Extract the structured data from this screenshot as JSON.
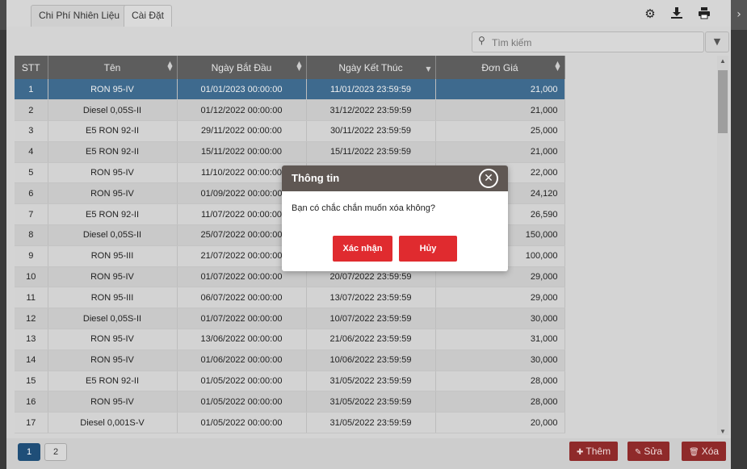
{
  "nav": {
    "collapse_icon": "collapse-left-icon",
    "collapse_glyph": "⏴II",
    "next_icon": "chevron-right-icon"
  },
  "tabs": [
    {
      "label": "Chi Phí Nhiên Liệu"
    },
    {
      "label": "Cài Đặt"
    }
  ],
  "toolbar": {
    "icons": [
      "gear-icon",
      "download-icon",
      "print-icon"
    ]
  },
  "search": {
    "placeholder": "Tìm kiếm",
    "icon": "search-icon"
  },
  "table": {
    "columns": [
      "STT",
      "Tên",
      "Ngày Bắt Đầu",
      "Ngày Kết Thúc",
      "Đơn Giá"
    ],
    "rows": [
      [
        "1",
        "RON 95-IV",
        "01/01/2023 00:00:00",
        "11/01/2023 23:59:59",
        "21,000"
      ],
      [
        "2",
        "Diesel 0,05S-II",
        "01/12/2022 00:00:00",
        "31/12/2022 23:59:59",
        "21,000"
      ],
      [
        "3",
        "E5 RON 92-II",
        "29/11/2022 00:00:00",
        "30/11/2022 23:59:59",
        "25,000"
      ],
      [
        "4",
        "E5 RON 92-II",
        "15/11/2022 00:00:00",
        "15/11/2022 23:59:59",
        "21,000"
      ],
      [
        "5",
        "RON 95-IV",
        "11/10/2022 00:00:00",
        "",
        "22,000"
      ],
      [
        "6",
        "RON 95-IV",
        "01/09/2022 00:00:00",
        "",
        "24,120"
      ],
      [
        "7",
        "E5 RON 92-II",
        "11/07/2022 00:00:00",
        "",
        "26,590"
      ],
      [
        "8",
        "Diesel 0,05S-II",
        "25/07/2022 00:00:00",
        "",
        "150,000"
      ],
      [
        "9",
        "RON 95-III",
        "21/07/2022 00:00:00",
        "",
        "100,000"
      ],
      [
        "10",
        "RON 95-IV",
        "01/07/2022 00:00:00",
        "20/07/2022 23:59:59",
        "29,000"
      ],
      [
        "11",
        "RON 95-III",
        "06/07/2022 00:00:00",
        "13/07/2022 23:59:59",
        "29,000"
      ],
      [
        "12",
        "Diesel 0,05S-II",
        "01/07/2022 00:00:00",
        "10/07/2022 23:59:59",
        "30,000"
      ],
      [
        "13",
        "RON 95-IV",
        "13/06/2022 00:00:00",
        "21/06/2022 23:59:59",
        "31,000"
      ],
      [
        "14",
        "RON 95-IV",
        "01/06/2022 00:00:00",
        "10/06/2022 23:59:59",
        "30,000"
      ],
      [
        "15",
        "E5 RON 92-II",
        "01/05/2022 00:00:00",
        "31/05/2022 23:59:59",
        "28,000"
      ],
      [
        "16",
        "RON 95-IV",
        "01/05/2022 00:00:00",
        "31/05/2022 23:59:59",
        "28,000"
      ],
      [
        "17",
        "Diesel 0,001S-V",
        "01/05/2022 00:00:00",
        "31/05/2022 23:59:59",
        "20,000"
      ]
    ]
  },
  "pagination": {
    "pages": [
      "1",
      "2"
    ]
  },
  "actions": {
    "add": "Thêm",
    "edit": "Sửa",
    "delete": "Xóa"
  },
  "dialog": {
    "title": "Thông tin",
    "message": "Bạn có chắc chắn muốn xóa không?",
    "confirm": "Xác nhận",
    "cancel": "Hủy"
  },
  "colors": {
    "selected_row": "#3e6a8e",
    "dialog_header": "#5f5753",
    "danger": "#e02b2f",
    "action_button": "#8f2a2a"
  }
}
